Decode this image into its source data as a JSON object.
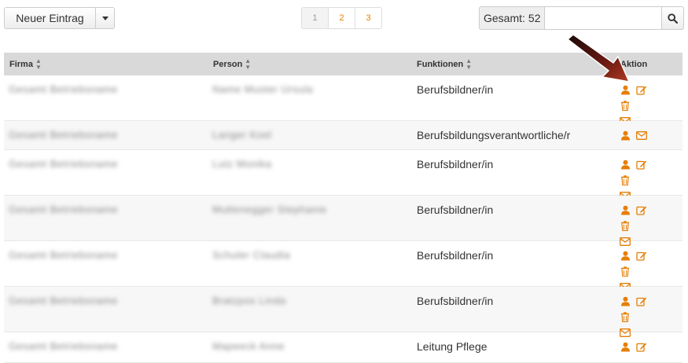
{
  "toolbar": {
    "new_entry_label": "Neuer Eintrag",
    "pages": [
      "1",
      "2",
      "3"
    ],
    "total_label": "Gesamt:",
    "total_count": "52",
    "search_placeholder": ""
  },
  "table": {
    "headers": {
      "firma": "Firma",
      "person": "Person",
      "funktionen": "Funktionen",
      "aktion": "Aktion"
    },
    "rows": [
      {
        "firma": "Gesamt Betriebsname",
        "person": "Name Muster Ursula",
        "funktion": "Berufsbildner/in"
      },
      {
        "firma": "Gesamt Betriebsname",
        "person": "Langer Koel",
        "funktion": "Berufsbildungsverantwortliche/r"
      },
      {
        "firma": "Gesamt Betriebsname",
        "person": "Lutz Monika",
        "funktion": "Berufsbildner/in"
      },
      {
        "firma": "Gesamt Betriebsname",
        "person": "Muttenegger Stephanie",
        "funktion": "Berufsbildner/in"
      },
      {
        "firma": "Gesamt Betriebsname",
        "person": "Schuler Claudia",
        "funktion": "Berufsbildner/in"
      },
      {
        "firma": "Gesamt Betriebsname",
        "person": "Bratzpos Linda",
        "funktion": "Berufsbildner/in"
      },
      {
        "firma": "Gesamt Betriebsname",
        "person": "Mapeeck Anne",
        "funktion": "Leitung Pflege"
      }
    ]
  },
  "colors": {
    "accent": "#e67e00",
    "header_bg": "#d9d9d9",
    "arrow": "#7a1a10"
  }
}
